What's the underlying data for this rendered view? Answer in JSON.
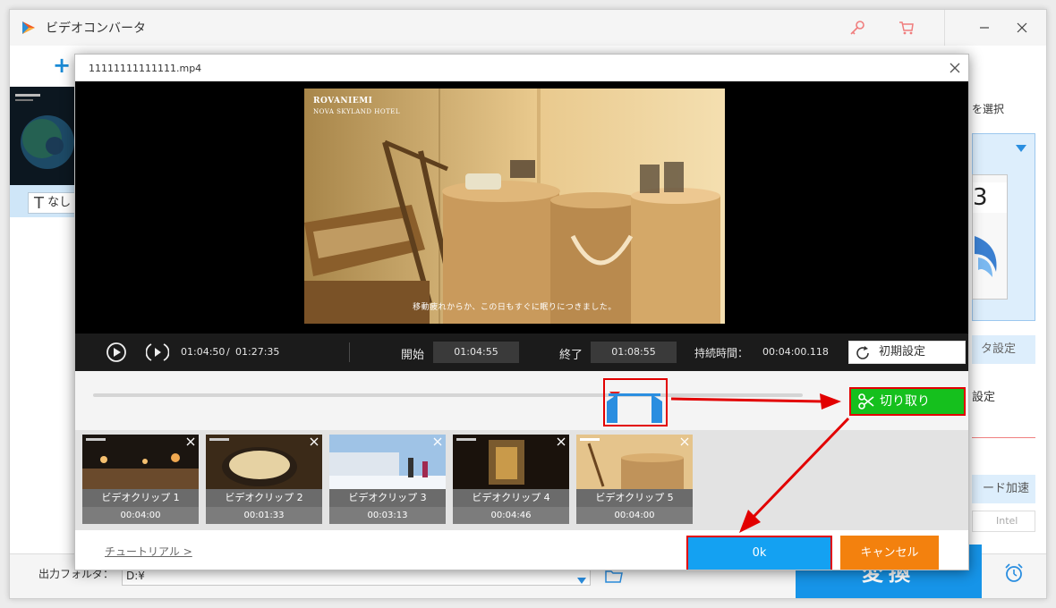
{
  "app": {
    "title": "ビデオコンバータ",
    "file_item": {
      "subtitle_none": "なし"
    },
    "right_panel": {
      "select_label": "を選択",
      "format_number": "3",
      "param_label": "タ設定",
      "setting_label": "設定",
      "hw_accel_label": "ード加速",
      "intel_label": "Intel"
    },
    "bottom": {
      "output_folder_label": "出力フォルダ：",
      "output_folder_value": "D:¥",
      "convert_label": "変換"
    }
  },
  "dialog": {
    "filename": "11111111111111.mp4",
    "video": {
      "overlay_line1": "ROVANIEMI",
      "overlay_line2": "NOVA SKYLAND HOTEL",
      "subtitle": "移動疲れからか、この日もすぐに眠りにつきました。"
    },
    "controls": {
      "current_time": "01:04:50",
      "separator": "/",
      "total_time": "01:27:35",
      "start_label": "開始",
      "start_value": "01:04:55",
      "end_label": "終了",
      "end_value": "01:08:55",
      "duration_label": "持続時間：",
      "duration_value": "00:04:00.118",
      "reset_label": "初期設定"
    },
    "trim": {
      "cut_label": "切り取り"
    },
    "clips": [
      {
        "name": "ビデオクリップ 1",
        "duration": "00:04:00"
      },
      {
        "name": "ビデオクリップ 2",
        "duration": "00:01:33"
      },
      {
        "name": "ビデオクリップ 3",
        "duration": "00:03:13"
      },
      {
        "name": "ビデオクリップ 4",
        "duration": "00:04:46"
      },
      {
        "name": "ビデオクリップ 5",
        "duration": "00:04:00"
      }
    ],
    "footer": {
      "tutorial_label": "チュートリアル >",
      "ok_label": "0k",
      "cancel_label": "キャンセル"
    }
  },
  "colors": {
    "accent_blue": "#1694e8",
    "cut_green": "#15c01d",
    "cancel_orange": "#f3810e",
    "highlight_red": "#e20000"
  }
}
